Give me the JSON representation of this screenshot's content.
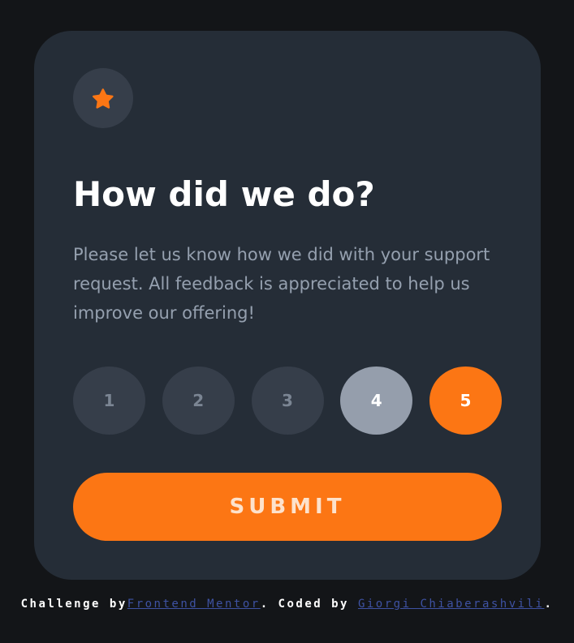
{
  "card": {
    "icon": "star-icon",
    "title": "How did we do?",
    "description": "Please let us know how we did with your support request. All feedback is appreciated to help us improve our offering!",
    "ratings": [
      "1",
      "2",
      "3",
      "4",
      "5"
    ],
    "hovered_rating": "4",
    "selected_rating": "5",
    "submit_label": "SUBMIT"
  },
  "attribution": {
    "challenge_prefix": "Challenge by",
    "challenge_link": "Frontend Mentor",
    "coded_prefix": ". Coded by",
    "author_link": "Giorgi Chiaberashvili",
    "suffix": "."
  },
  "colors": {
    "background": "#131518",
    "card": "#252d37",
    "accent": "#fc7614",
    "rating_idle": "#363e4a",
    "rating_hover": "#959eac",
    "text_muted": "#95a0af",
    "link": "#3e52a3"
  }
}
